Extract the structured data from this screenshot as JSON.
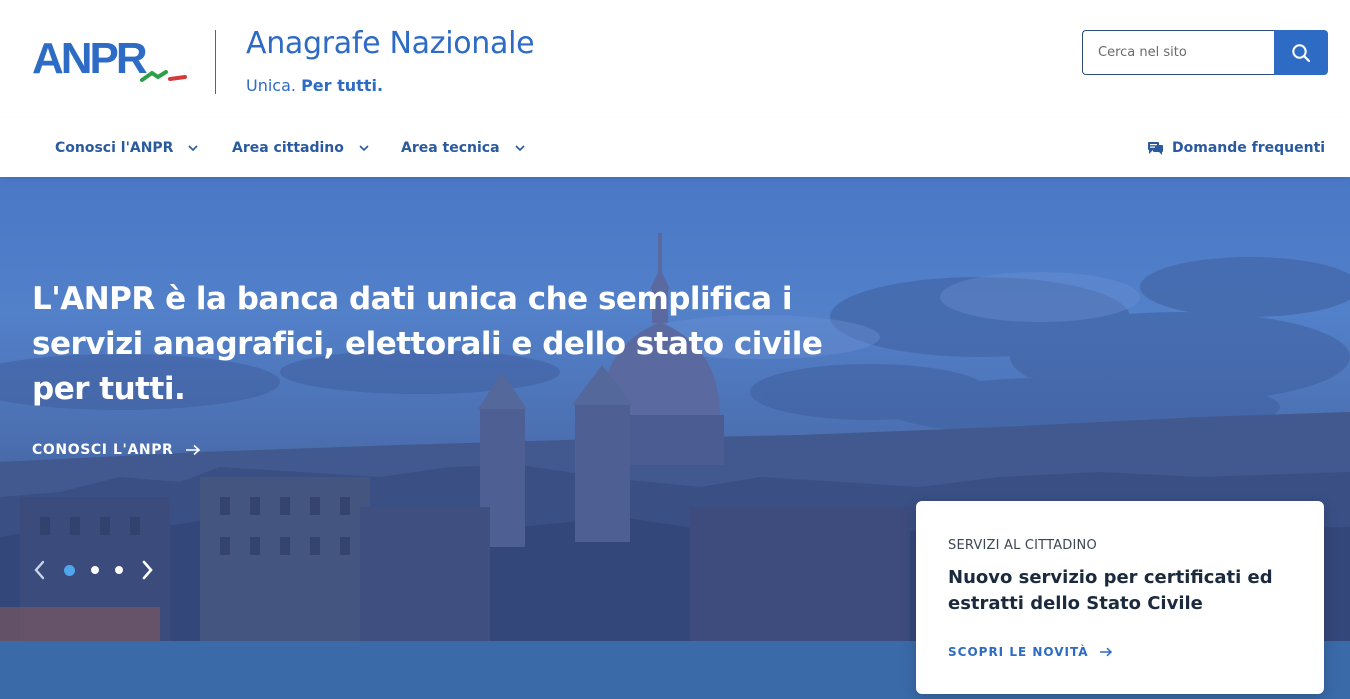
{
  "header": {
    "logo_text": "ANPR",
    "title": "Anagrafe Nazionale",
    "subtitle_plain": "Unica.",
    "subtitle_bold": "Per tutti.",
    "search_placeholder": "Cerca nel sito",
    "search_icon": "search-icon"
  },
  "nav": {
    "items": [
      {
        "label": "Conosci l'ANPR",
        "icon": "chevron-down-icon"
      },
      {
        "label": "Area cittadino",
        "icon": "chevron-down-icon"
      },
      {
        "label": "Area tecnica",
        "icon": "chevron-down-icon"
      }
    ],
    "faq": {
      "label": "Domande frequenti",
      "icon": "chat-icon"
    }
  },
  "hero": {
    "title_part1": "L'ANPR è la banca dati ",
    "title_bold1": "unica",
    "title_part2": " che semplifica i servizi anagrafici, elettorali e dello stato civile ",
    "title_bold2": "per tutti",
    "title_part3": ".",
    "cta_label": "CONOSCI L'ANPR",
    "cta_icon": "arrow-right-icon",
    "carousel": {
      "total_slides": 3,
      "active_slide": 1
    }
  },
  "card": {
    "kicker": "SERVIZI AL CITTADINO",
    "title": "Nuovo servizio per certificati ed estratti dello Stato Civile",
    "link_label": "SCOPRI LE NOVITÀ",
    "link_icon": "arrow-right-icon"
  },
  "colors": {
    "brand_blue": "#2d6bc4",
    "nav_text": "#2a5a9e",
    "active_dot": "#4fa6ea",
    "flag_green": "#2e9e48",
    "flag_red": "#d33a3a"
  }
}
